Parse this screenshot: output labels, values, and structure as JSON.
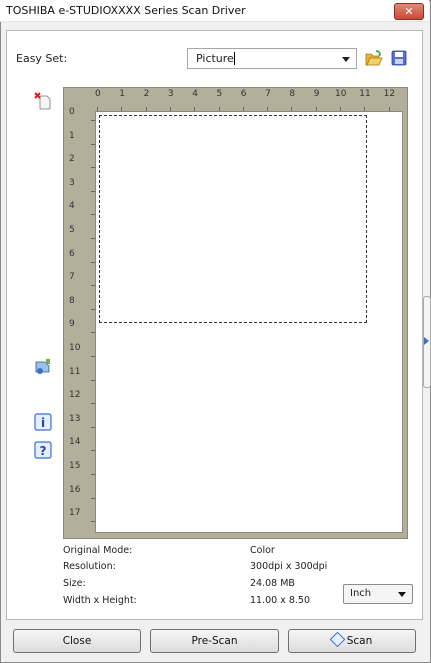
{
  "window": {
    "title": "TOSHIBA e-STUDIOXXXX Series Scan Driver",
    "close_glyph": "✕"
  },
  "easy_set": {
    "label": "Easy Set:",
    "value": "Picture",
    "open_icon": "folder-open-icon",
    "save_icon": "floppy-save-icon"
  },
  "side_icons": [
    "eraser-reset-icon",
    "scanner-settings-icon",
    "info-icon",
    "help-icon"
  ],
  "ruler": {
    "top_ticks": [
      "0",
      "1",
      "2",
      "3",
      "4",
      "5",
      "6",
      "7",
      "8",
      "9",
      "10",
      "11",
      "12"
    ],
    "left_ticks": [
      "0",
      "1",
      "2",
      "3",
      "4",
      "5",
      "6",
      "7",
      "8",
      "9",
      "10",
      "11",
      "12",
      "13",
      "14",
      "15",
      "16",
      "17"
    ]
  },
  "info": {
    "original_mode_label": "Original Mode:",
    "original_mode_value": "Color",
    "resolution_label": "Resolution:",
    "resolution_value": "300dpi x 300dpi",
    "size_label": "Size:",
    "size_value": "24.08 MB",
    "wh_label": "Width x Height:",
    "wh_value": "11.00 x 8.50"
  },
  "unit": {
    "value": "Inch"
  },
  "buttons": {
    "close": "Close",
    "prescan": "Pre-Scan",
    "scan": "Scan"
  },
  "colors": {
    "ruler_bg": "#b2b09a",
    "accent": "#3a6fd1",
    "close_red": "#c74a35"
  }
}
